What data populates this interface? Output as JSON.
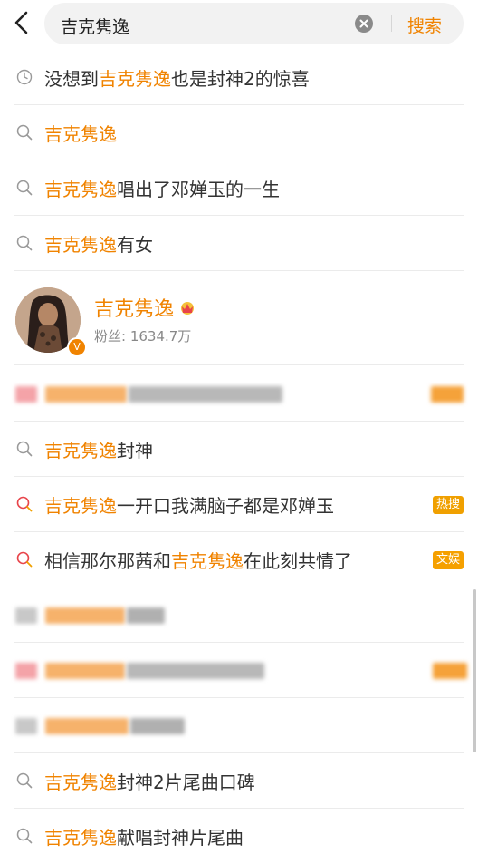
{
  "search": {
    "query": "吉克隽逸",
    "button_label": "搜索"
  },
  "items": [
    {
      "before": "没想到",
      "highlight": "吉克隽逸",
      "after": "也是封神2的惊喜",
      "icon": "clock-icon"
    },
    {
      "before": "",
      "highlight": "吉克隽逸",
      "after": "",
      "icon": "search-icon"
    },
    {
      "before": "",
      "highlight": "吉克隽逸",
      "after": "唱出了邓婵玉的一生",
      "icon": "search-icon"
    },
    {
      "before": "",
      "highlight": "吉克隽逸",
      "after": "有女",
      "icon": "search-icon"
    },
    {
      "before": "",
      "highlight": "吉克隽逸",
      "after": "封神",
      "icon": "search-icon"
    },
    {
      "before": "",
      "highlight": "吉克隽逸",
      "after": "一开口我满脑子都是邓婵玉",
      "icon": "hot-search-icon",
      "badge": "热搜"
    },
    {
      "before": "相信那尔那茜和",
      "highlight": "吉克隽逸",
      "after": "在此刻共情了",
      "icon": "hot-search-icon",
      "badge": "文娱"
    },
    {
      "before": "",
      "highlight": "吉克隽逸",
      "after": "封神2片尾曲口碑",
      "icon": "search-icon"
    },
    {
      "before": "",
      "highlight": "吉克隽逸",
      "after": "献唱封神片尾曲",
      "icon": "search-icon"
    }
  ],
  "profile": {
    "name": "吉克隽逸",
    "fans": "粉丝: 1634.7万"
  },
  "colors": {
    "accent": "#f08300",
    "hot_badge": "#f0a000",
    "ent_badge": "#f5a000"
  }
}
